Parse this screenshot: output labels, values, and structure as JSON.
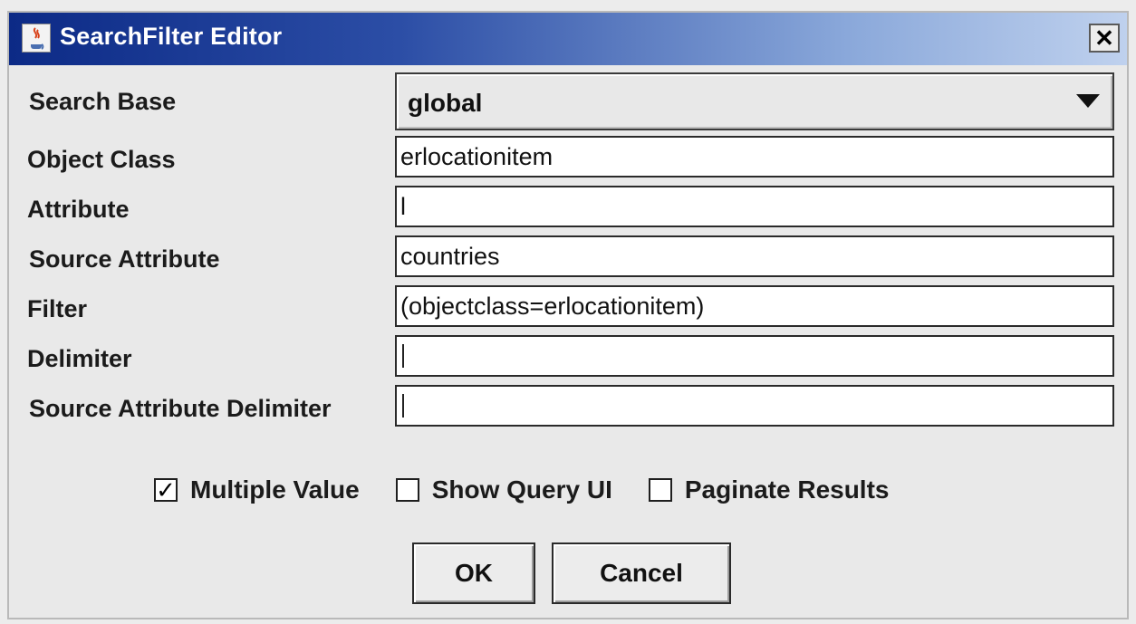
{
  "window": {
    "title": "SearchFilter Editor",
    "close_label": "✕"
  },
  "form": {
    "search_base": {
      "label": "Search Base",
      "value": "global"
    },
    "object_class": {
      "label": "Object Class",
      "value": "erlocationitem"
    },
    "attribute": {
      "label": "Attribute",
      "value": "l"
    },
    "source_attribute": {
      "label": "Source Attribute",
      "value": "countries"
    },
    "filter": {
      "label": "Filter",
      "value": "(objectclass=erlocationitem)"
    },
    "delimiter": {
      "label": "Delimiter",
      "value": ""
    },
    "source_attribute_delimiter": {
      "label": "Source Attribute Delimiter",
      "value": ""
    }
  },
  "options": [
    {
      "label": "Multiple Value",
      "checked": true,
      "mark": "✓"
    },
    {
      "label": "Show Query UI",
      "checked": false,
      "mark": ""
    },
    {
      "label": "Paginate Results",
      "checked": false,
      "mark": ""
    }
  ],
  "buttons": {
    "ok": "OK",
    "cancel": "Cancel"
  },
  "icons": {
    "app": "java-cup-icon",
    "close": "close-icon",
    "dropdown": "triangle-down-icon"
  }
}
